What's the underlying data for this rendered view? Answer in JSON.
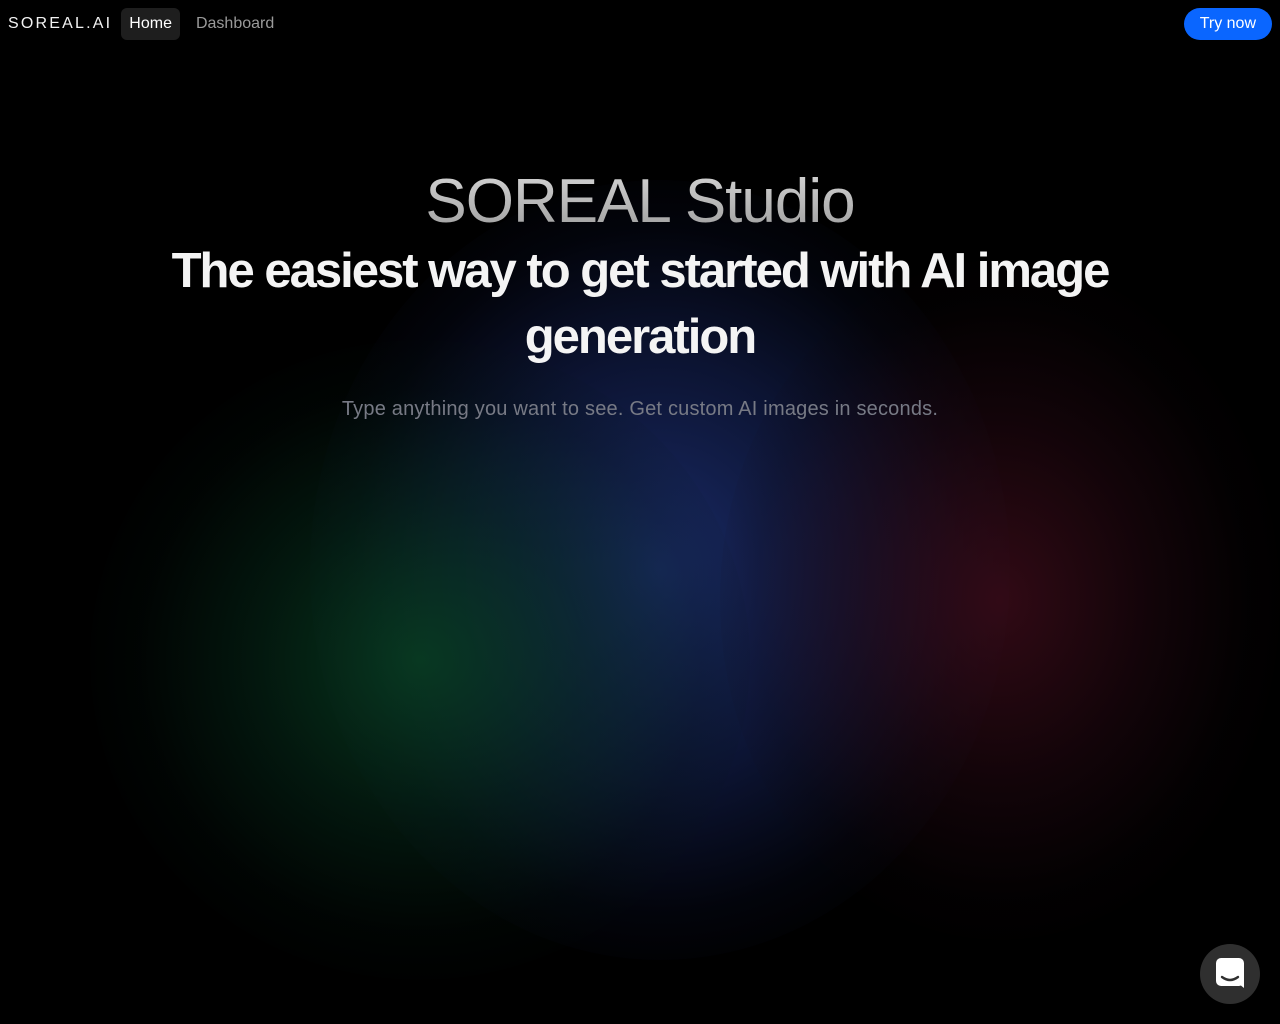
{
  "nav": {
    "logo": "SOREAL.AI",
    "links": [
      {
        "label": "Home",
        "active": true
      },
      {
        "label": "Dashboard",
        "active": false
      }
    ],
    "cta_label": "Try now"
  },
  "hero": {
    "title": "SOREAL Studio",
    "subtitle": "The easiest way to get started with AI image generation",
    "description": "Type anything you want to see. Get custom AI images in seconds."
  },
  "chat_launcher": {
    "icon": "chat-icon"
  },
  "colors": {
    "background": "#000000",
    "accent": "#0a66ff",
    "glow_blue": "#1e3278",
    "glow_green": "#084022",
    "glow_red": "#460e1e"
  }
}
